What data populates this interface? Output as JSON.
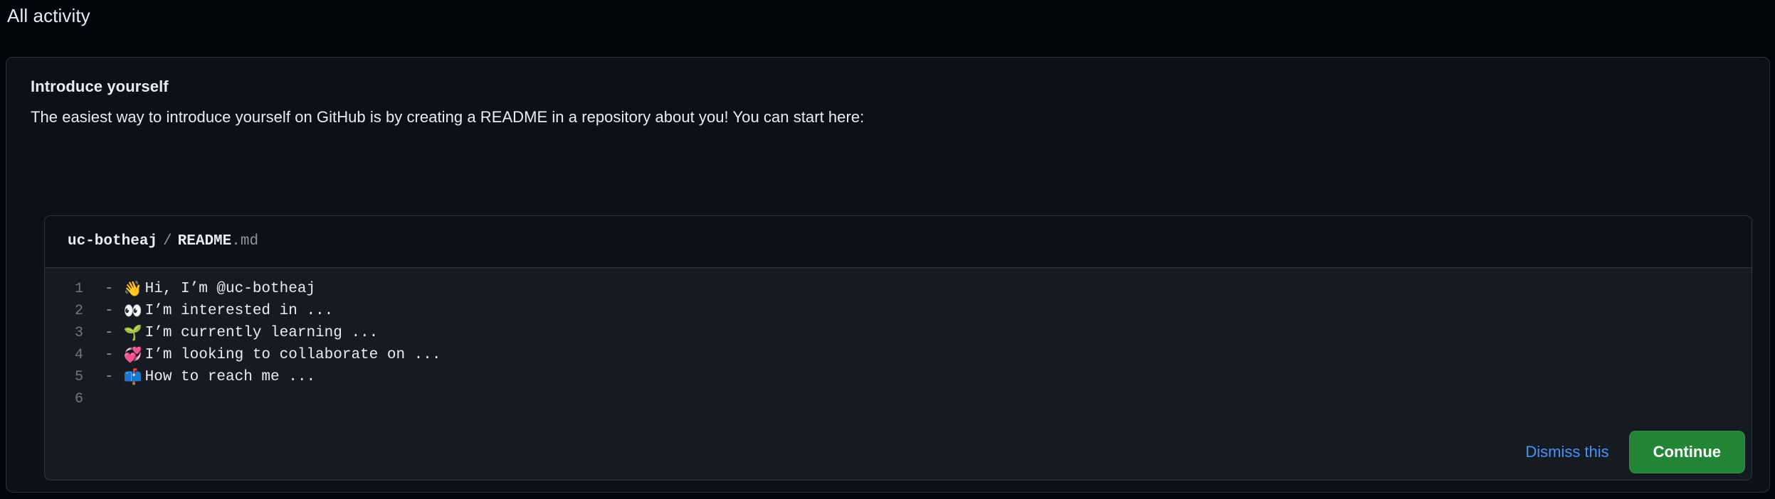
{
  "section": {
    "heading": "All activity"
  },
  "card": {
    "title": "Introduce yourself",
    "description": "The easiest way to introduce yourself on GitHub is by creating a README in a repository about you! You can start here:",
    "file_preview": {
      "owner": "uc-botheaj",
      "separator": "/",
      "file_name": "README",
      "file_extension": ".md",
      "lines": [
        {
          "number": "1",
          "dash": "-",
          "emoji": "👋",
          "text": "Hi, I’m @uc-botheaj"
        },
        {
          "number": "2",
          "dash": "-",
          "emoji": "👀",
          "text": "I’m interested in ..."
        },
        {
          "number": "3",
          "dash": "-",
          "emoji": "🌱",
          "text": "I’m currently learning ..."
        },
        {
          "number": "4",
          "dash": "-",
          "emoji": "💞",
          "text": "I’m looking to collaborate on ..."
        },
        {
          "number": "5",
          "dash": "-",
          "emoji": "📫",
          "text": "How to reach me ..."
        },
        {
          "number": "6",
          "dash": "",
          "emoji": "",
          "text": ""
        }
      ]
    },
    "actions": {
      "dismiss_label": "Dismiss this",
      "continue_label": "Continue"
    }
  },
  "colors": {
    "page_background": "#010409",
    "card_background": "#0d1117",
    "code_background": "#161b22",
    "border": "#30363d",
    "text_primary": "#e6edf3",
    "text_muted": "#8b949e",
    "line_number": "#6e7681",
    "link_blue": "#4493f8",
    "button_green": "#238636"
  }
}
